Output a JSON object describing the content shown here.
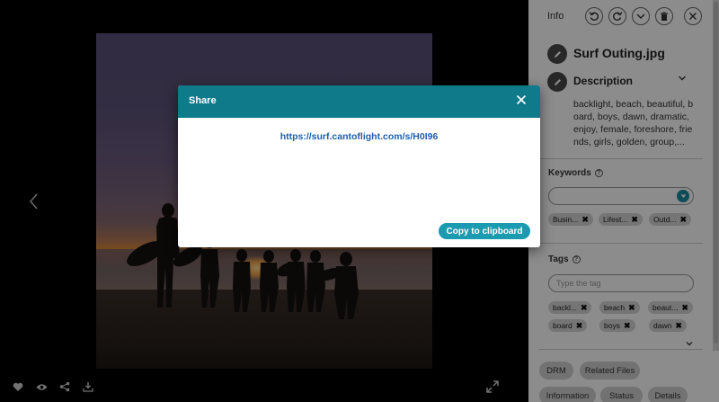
{
  "viewer": {
    "prev_icon": "chevron-left-icon",
    "tools": [
      {
        "icon": "heart-icon"
      },
      {
        "icon": "eye-icon"
      },
      {
        "icon": "share-icon"
      },
      {
        "icon": "download-icon"
      }
    ],
    "expand_icon": "expand-icon"
  },
  "panel": {
    "title": "Info",
    "header_buttons": [
      "rotate-left-icon",
      "rotate-right-icon",
      "chevron-down-icon",
      "trash-icon",
      "close-icon"
    ],
    "file_name": "Surf Outing.jpg",
    "description_title": "Description",
    "description_text": "backlight, beach, beautiful, board, boys, dawn, dramatic, enjoy, female, foreshore, friends, girls, golden, group,...",
    "keywords_label": "Keywords",
    "keyword_chips": [
      "Busin...",
      "Lifest...",
      "Outd..."
    ],
    "tags_label": "Tags",
    "tag_placeholder": "Type the tag",
    "tag_chips": [
      "backl...",
      "beach",
      "beaut...",
      "board",
      "boys",
      "dawn"
    ],
    "bottom_pills": [
      "DRM",
      "Related Files",
      "Information",
      "Status",
      "Details"
    ]
  },
  "dialog": {
    "title": "Share",
    "link": "https://surf.cantoflight.com/s/H0I96",
    "copy_label": "Copy to clipboard"
  },
  "colors": {
    "accent": "#0f7a8a",
    "button": "#1a9bb0",
    "link": "#1f5fa8"
  }
}
